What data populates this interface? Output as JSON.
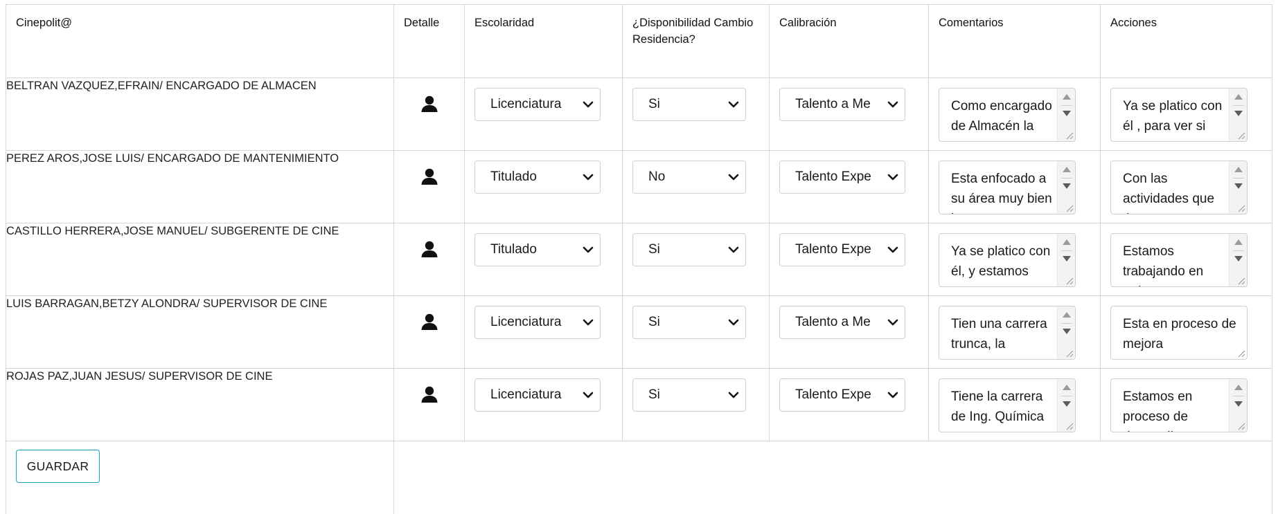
{
  "headers": {
    "cinepolita": "Cinepolit@",
    "detalle": "Detalle",
    "escolaridad": "Escolaridad",
    "disponibilidad": "¿Disponibilidad Cambio Residencia?",
    "calibracion": "Calibración",
    "comentarios": "Comentarios",
    "acciones": "Acciones"
  },
  "rows": [
    {
      "name": "BELTRAN VAZQUEZ,EFRAIN/ ENCARGADO DE ALMACEN",
      "detail_icon": "user-icon",
      "escolaridad": "Licenciatura",
      "disponibilidad": "Si",
      "calibracion": "Talento a Me",
      "comentarios": "Como encargado de Almacén la",
      "acciones": "Ya se platico con él , para ver si"
    },
    {
      "name": "PEREZ AROS,JOSE LUIS/ ENCARGADO DE MANTENIMIENTO",
      "detail_icon": "user-icon",
      "escolaridad": "Titulado",
      "disponibilidad": "No",
      "calibracion": "Talento Expe",
      "comentarios": "Esta enfocado a su área muy bien lo",
      "acciones": "Con las actividades que tiene"
    },
    {
      "name": "CASTILLO HERRERA,JOSE MANUEL/ SUBGERENTE DE CINE",
      "detail_icon": "user-icon",
      "escolaridad": "Titulado",
      "disponibilidad": "Si",
      "calibracion": "Talento Expe",
      "comentarios": "Ya se platico con él, y estamos",
      "acciones": "Estamos trabajando en todo"
    },
    {
      "name": "LUIS BARRAGAN,BETZY ALONDRA/ SUPERVISOR DE CINE",
      "detail_icon": "user-icon",
      "escolaridad": "Licenciatura",
      "disponibilidad": "Si",
      "calibracion": "Talento a Me",
      "comentarios": "Tien una carrera trunca, la",
      "acciones": "Esta en proceso de mejora"
    },
    {
      "name": "ROJAS PAZ,JUAN JESUS/ SUPERVISOR DE CINE",
      "detail_icon": "user-icon",
      "escolaridad": "Licenciatura",
      "disponibilidad": "Si",
      "calibracion": "Talento Expe",
      "comentarios": "Tiene la carrera de Ing. Química",
      "acciones": "Estamos en proceso de desarrollo"
    }
  ],
  "save_button": "GUARDAR",
  "colors": {
    "border": "#d6d6d6",
    "button_border": "#1aa3c4",
    "icon": "#111111"
  }
}
